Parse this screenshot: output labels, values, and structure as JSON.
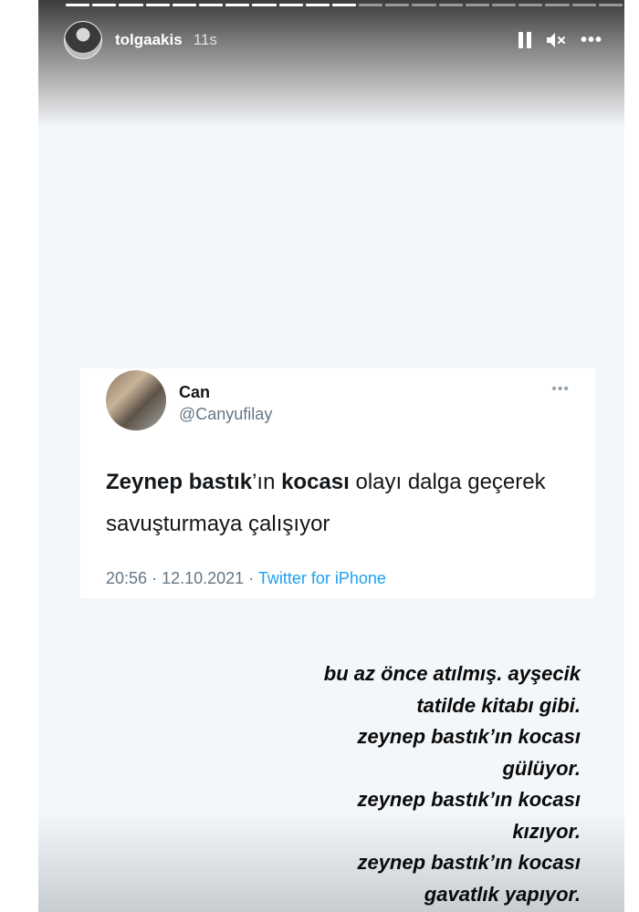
{
  "story": {
    "username": "tolgaakis",
    "time": "11s",
    "progress_total": 21,
    "progress_done": 11,
    "controls": {
      "pause_icon": "pause-icon",
      "mute_icon": "speaker-muted-icon",
      "more_label": "•••"
    }
  },
  "tweet": {
    "name": "Can",
    "handle": "@Canyufilay",
    "more_label": "•••",
    "text": {
      "bold1": "Zeynep bastık",
      "normal1": "’ın ",
      "bold2": "kocası",
      "normal2": " olayı dalga geçerek savuşturmaya çalışıyor"
    },
    "time": "20:56",
    "date": "12.10.2021",
    "separator": "·",
    "source": "Twitter for iPhone"
  },
  "caption": {
    "lines": [
      "bu az önce atılmış. ayşecik",
      "tatilde kitabı gibi.",
      "zeynep bastık’ın kocası",
      "gülüyor.",
      "zeynep bastık’ın kocası",
      "kızıyor.",
      "zeynep bastık’ın kocası",
      "gavatlık yapıyor."
    ]
  }
}
